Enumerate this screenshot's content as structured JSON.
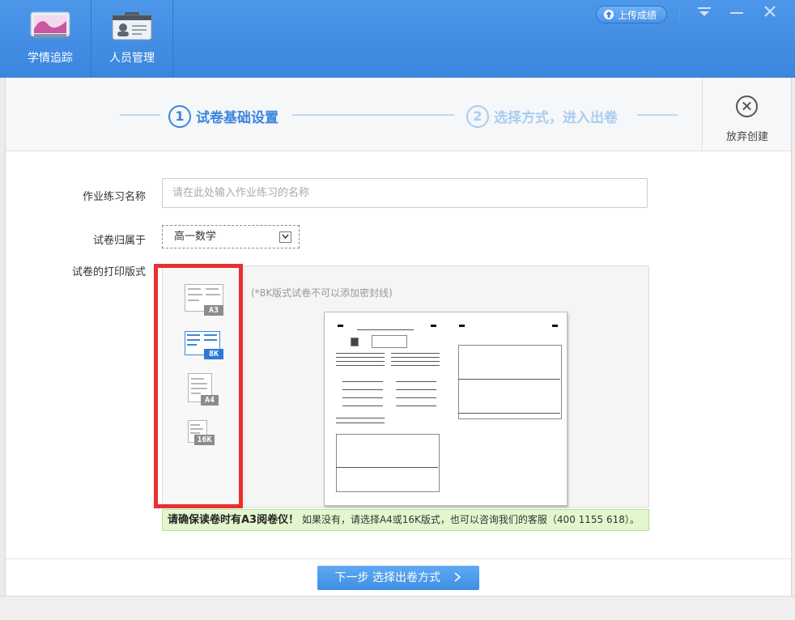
{
  "nav": {
    "items": [
      {
        "label": "学情追踪",
        "icon": "chart-monitor-icon"
      },
      {
        "label": "人员管理",
        "icon": "id-card-icon"
      }
    ]
  },
  "titlebar": {
    "upload_label": "上传成绩",
    "controls": [
      "dropdown-menu",
      "minimize",
      "close"
    ]
  },
  "steps": [
    {
      "number": "1",
      "label": "试卷基础设置",
      "active": true
    },
    {
      "number": "2",
      "label": "选择方式，进入出卷",
      "active": false
    }
  ],
  "abandon_label": "放弃创建",
  "form": {
    "name_label": "作业练习名称",
    "name_placeholder": "请在此处输入作业练习的名称",
    "subject_label": "试卷归属于",
    "subject_value": "高一数学",
    "format_label": "试卷的打印版式"
  },
  "formats": [
    {
      "tag": "A3",
      "selected": false
    },
    {
      "tag": "8K",
      "selected": true
    },
    {
      "tag": "A4",
      "selected": false
    },
    {
      "tag": "16K",
      "selected": false
    }
  ],
  "format_note": "(*8K版式试卷不可以添加密封线)",
  "warning": {
    "bold": "请确保读卷时有A3阅卷仪！",
    "text": "如果没有，请选择A4或16K版式，也可以咨询我们的客服（400 1155 618）。"
  },
  "next_button_label": "下一步 选择出卷方式",
  "colors": {
    "accent": "#3b86de",
    "highlight_border": "#e8302f",
    "warning_bg": "#e3f7cf"
  }
}
